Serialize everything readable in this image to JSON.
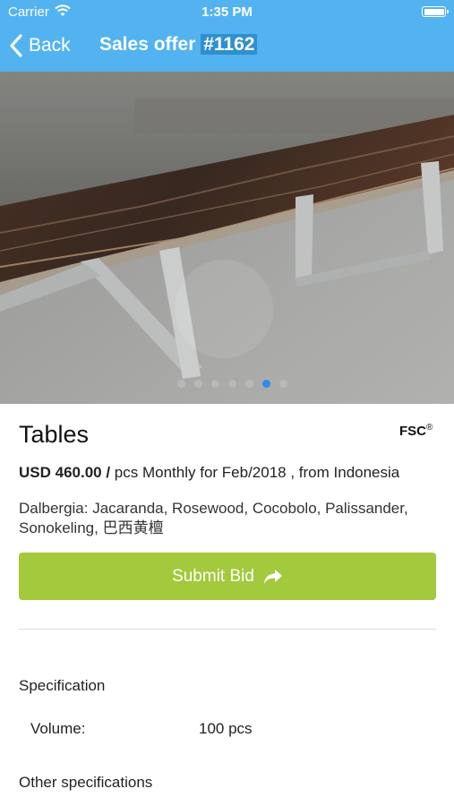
{
  "status_bar": {
    "carrier": "Carrier",
    "time": "1:35 PM"
  },
  "nav": {
    "back_label": "Back",
    "title": "Sales offer",
    "offer_id": "#1162"
  },
  "carousel": {
    "page_count": 7,
    "active_index": 5
  },
  "product": {
    "title": "Tables",
    "certification": "FSC",
    "certification_mark": "®",
    "price": "USD 460.00 /",
    "price_detail": "pcs Monthly for Feb/2018 , from Indonesia",
    "species": "Dalbergia: Jacaranda, Rosewood, Cocobolo, Palissander, Sonokeling, 巴西黄檀"
  },
  "actions": {
    "submit_label": "Submit Bid",
    "submit_icon": "share-arrow-icon",
    "submit_color": "#a3c93c"
  },
  "specification": {
    "heading": "Specification",
    "rows": [
      {
        "label": "Volume:",
        "value": "100 pcs"
      }
    ]
  },
  "other_specifications": {
    "heading": "Other specifications"
  },
  "colors": {
    "header": "#53b3f0",
    "active_dot": "#2b8cf2"
  }
}
